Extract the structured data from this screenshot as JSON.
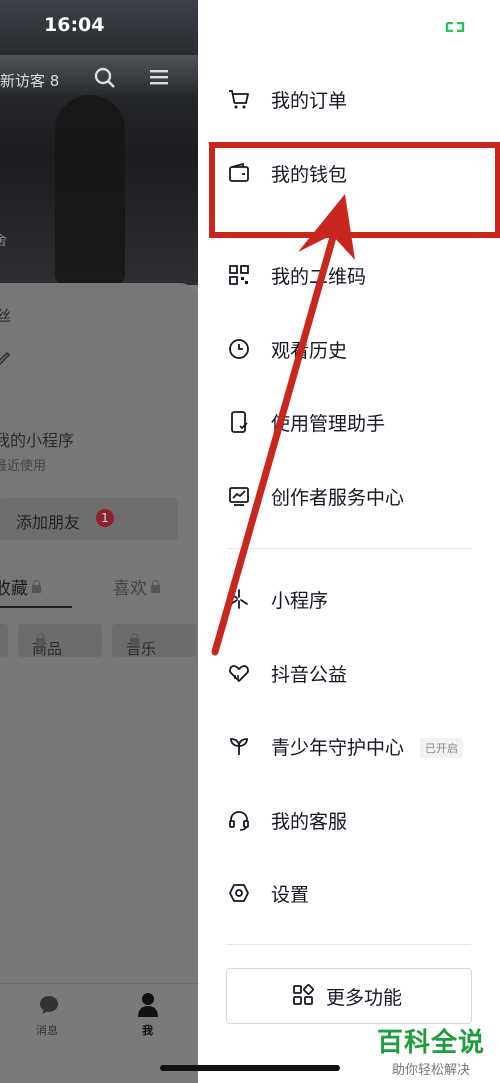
{
  "status_bar": {
    "time": "16:04"
  },
  "profile": {
    "visitors": "新访客 8",
    "row1_frag": "丝",
    "my_mini_program": "我的小程序",
    "recently_used": "最近使用",
    "add_friend": "添加朋友",
    "add_friend_badge": "1",
    "tabs": [
      {
        "label": "收藏"
      },
      {
        "label": "喜欢"
      }
    ],
    "chips": [
      {
        "label": "商品"
      },
      {
        "label": "音乐"
      }
    ],
    "bottom_nav": [
      {
        "label": "消息"
      },
      {
        "label": "我"
      }
    ]
  },
  "drawer": {
    "menu_items": [
      {
        "label": "我的订单",
        "icon": "cart-icon"
      },
      {
        "label": "我的钱包",
        "icon": "wallet-icon"
      },
      {
        "label": "我的二维码",
        "icon": "qr-code-icon"
      },
      {
        "label": "观看历史",
        "icon": "clock-icon"
      },
      {
        "label": "使用管理助手",
        "icon": "phone-check-icon"
      },
      {
        "label": "创作者服务中心",
        "icon": "chart-icon"
      },
      {
        "label": "小程序",
        "icon": "mini-program-icon"
      },
      {
        "label": "抖音公益",
        "icon": "heart-hand-icon"
      },
      {
        "label": "青少年守护中心",
        "icon": "sprout-icon",
        "tag": "已开启"
      },
      {
        "label": "我的客服",
        "icon": "headset-icon"
      },
      {
        "label": "设置",
        "icon": "settings-icon"
      }
    ],
    "more_button": "更多功能"
  },
  "annotation": {
    "color": "#c9271e"
  },
  "watermark": {
    "title": "百科全说",
    "subtitle": "助你轻松解决"
  },
  "colors": {
    "accent_red": "#c9271e",
    "watermark_green": "#1e9e3e"
  }
}
